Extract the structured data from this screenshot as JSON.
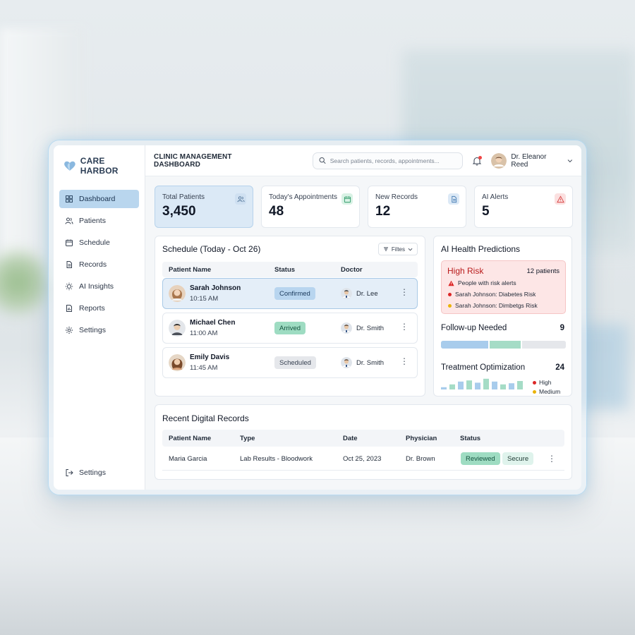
{
  "app": {
    "brand": "CARE HARBOR",
    "page_title": "CLINIC MANAGEMENT DASHBOARD"
  },
  "search": {
    "placeholder": "Search patients, records, appointments..."
  },
  "user": {
    "name": "Dr. Eleanor Reed"
  },
  "sidebar": {
    "items": [
      {
        "label": "Dashboard",
        "icon": "grid-icon",
        "active": true
      },
      {
        "label": "Patients",
        "icon": "users-icon"
      },
      {
        "label": "Schedule",
        "icon": "calendar-icon"
      },
      {
        "label": "Records",
        "icon": "document-icon"
      },
      {
        "label": "AI Insights",
        "icon": "lightbulb-icon"
      },
      {
        "label": "Reports",
        "icon": "report-icon"
      },
      {
        "label": "Settings",
        "icon": "gear-icon"
      }
    ],
    "bottom": {
      "label": "Settings",
      "icon": "logout-icon"
    }
  },
  "stats": [
    {
      "label": "Total Patients",
      "value": "3,450",
      "icon": "users-icon",
      "color": "#6b8fb5"
    },
    {
      "label": "Today's Appointments",
      "value": "48",
      "icon": "calendar-icon",
      "color": "#3aa776"
    },
    {
      "label": "New Records",
      "value": "12",
      "icon": "document-icon",
      "color": "#4a7fb5"
    },
    {
      "label": "AI Alerts",
      "value": "5",
      "icon": "alert-icon",
      "color": "#e05252"
    }
  ],
  "schedule": {
    "title": "Schedule (Today - Oct 26)",
    "filters_label": "Filtes",
    "columns": [
      "Patient Name",
      "Status",
      "Doctor"
    ],
    "rows": [
      {
        "name": "Sarah Johnson",
        "time": "10:15 AM",
        "status": "Confirmed",
        "doctor": "Dr. Lee"
      },
      {
        "name": "Michael Chen",
        "time": "11:00 AM",
        "status": "Arrived",
        "doctor": "Dr. Smith"
      },
      {
        "name": "Emily Davis",
        "time": "11:45 AM",
        "status": "Scheduled",
        "doctor": "Dr. Smith"
      }
    ]
  },
  "ai": {
    "title": "AI Health Predictions",
    "high_risk": {
      "title": "High Risk",
      "count": "12 patients",
      "alert": "People with risk alerts",
      "items": [
        "Sarah Johnson: Diabetes Risk",
        "Sarah Johnson: Dimbetgs Risk"
      ]
    },
    "follow_up": {
      "title": "Follow-up Needed",
      "count": "9",
      "segments": [
        0.39,
        0.26,
        0.35
      ]
    },
    "treatment": {
      "title": "Treatment Optimization",
      "count": "24",
      "legend": [
        "High",
        "Medium"
      ],
      "bars": [
        0.2,
        0.45,
        0.7,
        0.8,
        0.6,
        0.95,
        0.7,
        0.45,
        0.55,
        0.75
      ]
    }
  },
  "records": {
    "title": "Recent Digital Records",
    "columns": [
      "Patient Name",
      "Type",
      "Date",
      "Physician",
      "Status"
    ],
    "rows": [
      {
        "patient": "Maria Garcia",
        "type": "Lab Results - Bloodwork",
        "date": "Oct 25, 2023",
        "physician": "Dr. Brown",
        "status": "Reviewed",
        "tag": "Secure"
      }
    ]
  },
  "colors": {
    "accent": "#b9d6ee",
    "arrived": "#9edcc2",
    "risk": "#fde6e6",
    "follow_blue": "#a8ccec",
    "follow_green": "#a5dcc6"
  }
}
